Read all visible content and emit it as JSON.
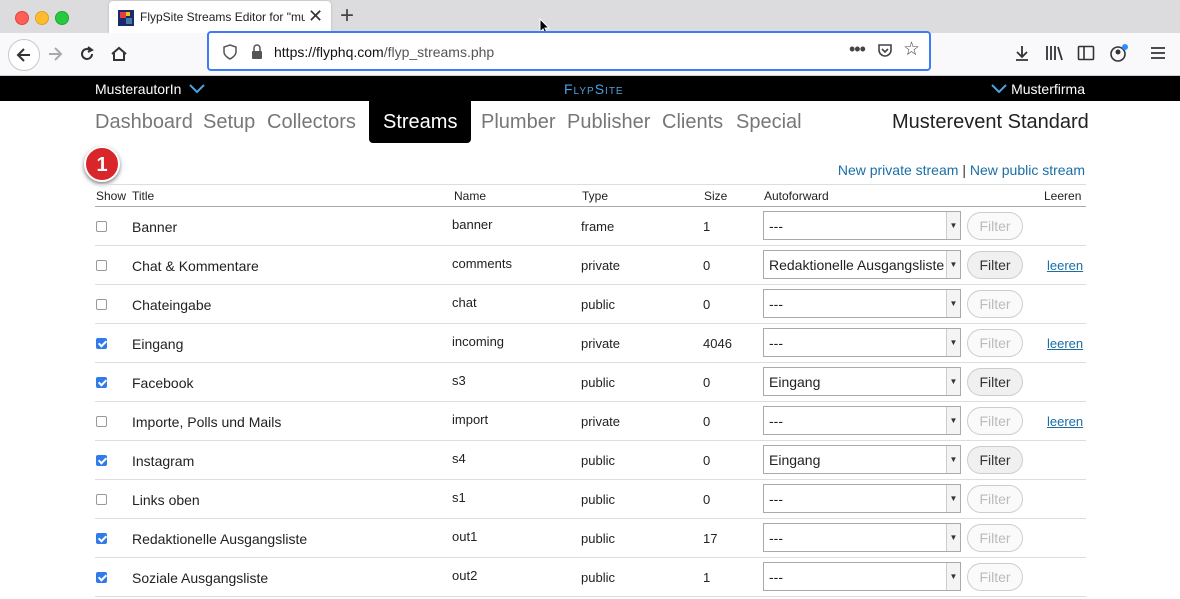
{
  "browser": {
    "tab_title": "FlypSite Streams Editor for \"mu",
    "url_host": "https://flyphq.com",
    "url_path": "/flyp_streams.php"
  },
  "topbar": {
    "user": "MusterautorIn",
    "brand": "FlypSite",
    "company": "Musterfirma"
  },
  "menu": [
    {
      "label": "Dashboard",
      "active": false
    },
    {
      "label": "Setup",
      "active": false
    },
    {
      "label": "Collectors",
      "active": false
    },
    {
      "label": "Streams",
      "active": true
    },
    {
      "label": "Plumber",
      "active": false
    },
    {
      "label": "Publisher",
      "active": false
    },
    {
      "label": "Clients",
      "active": false
    },
    {
      "label": "Special",
      "active": false
    }
  ],
  "event_name": "Musterevent Standard",
  "badge": "1",
  "links": {
    "new_private": "New private stream",
    "separator": "|",
    "new_public": "New public stream"
  },
  "table": {
    "headers": {
      "show": "Show",
      "title": "Title",
      "name": "Name",
      "type": "Type",
      "size": "Size",
      "autoforward": "Autoforward",
      "leeren": "Leeren"
    },
    "filter_label": "Filter",
    "leeren_label": "leeren",
    "rows": [
      {
        "show": false,
        "title": "Banner",
        "name": "banner",
        "type": "frame",
        "size": "1",
        "autoforward": "---",
        "filter_enabled": false,
        "leeren": false
      },
      {
        "show": false,
        "title": "Chat & Kommentare",
        "name": "comments",
        "type": "private",
        "size": "0",
        "autoforward": "Redaktionelle Ausgangsliste",
        "filter_enabled": true,
        "leeren": true
      },
      {
        "show": false,
        "title": "Chateingabe",
        "name": "chat",
        "type": "public",
        "size": "0",
        "autoforward": "---",
        "filter_enabled": false,
        "leeren": false
      },
      {
        "show": true,
        "title": "Eingang",
        "name": "incoming",
        "type": "private",
        "size": "4046",
        "autoforward": "---",
        "filter_enabled": false,
        "leeren": true
      },
      {
        "show": true,
        "title": "Facebook",
        "name": "s3",
        "type": "public",
        "size": "0",
        "autoforward": "Eingang",
        "filter_enabled": true,
        "leeren": false
      },
      {
        "show": false,
        "title": "Importe, Polls und Mails",
        "name": "import",
        "type": "private",
        "size": "0",
        "autoforward": "---",
        "filter_enabled": false,
        "leeren": true
      },
      {
        "show": true,
        "title": "Instagram",
        "name": "s4",
        "type": "public",
        "size": "0",
        "autoforward": "Eingang",
        "filter_enabled": true,
        "leeren": false
      },
      {
        "show": false,
        "title": "Links oben",
        "name": "s1",
        "type": "public",
        "size": "0",
        "autoforward": "---",
        "filter_enabled": false,
        "leeren": false
      },
      {
        "show": true,
        "title": "Redaktionelle Ausgangsliste",
        "name": "out1",
        "type": "public",
        "size": "17",
        "autoforward": "---",
        "filter_enabled": false,
        "leeren": false
      },
      {
        "show": true,
        "title": "Soziale Ausgangsliste",
        "name": "out2",
        "type": "public",
        "size": "1",
        "autoforward": "---",
        "filter_enabled": false,
        "leeren": false
      }
    ]
  }
}
